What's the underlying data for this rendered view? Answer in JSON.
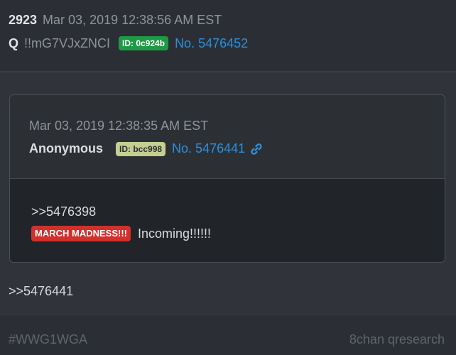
{
  "post": {
    "number": "2923",
    "timestamp": "Mar 03, 2019 12:38:56 AM EST",
    "author": "Q",
    "tripcode": "!!mG7VJxZNCI",
    "id_badge": "ID: 0c924b",
    "post_link": "No. 5476452",
    "reply_text": ">>5476441"
  },
  "quoted_post": {
    "timestamp": "Mar 03, 2019 12:38:35 AM EST",
    "author": "Anonymous",
    "id_badge": "ID: bcc998",
    "post_link": "No. 5476441",
    "quote_ref": ">>5476398",
    "red_tag": "MARCH MADNESS!!!",
    "message": "Incoming!!!!!!"
  },
  "footer": {
    "hashtag": "#WWG1WGA",
    "source": "8chan qresearch"
  },
  "icons": {
    "link_icon": "chain-link-icon"
  },
  "colors": {
    "background": "#2b2f35",
    "link_blue": "#2e8fdb",
    "id_green": "#1e9a45",
    "id_olive": "#c5cf90",
    "tag_red": "#d0312d"
  }
}
